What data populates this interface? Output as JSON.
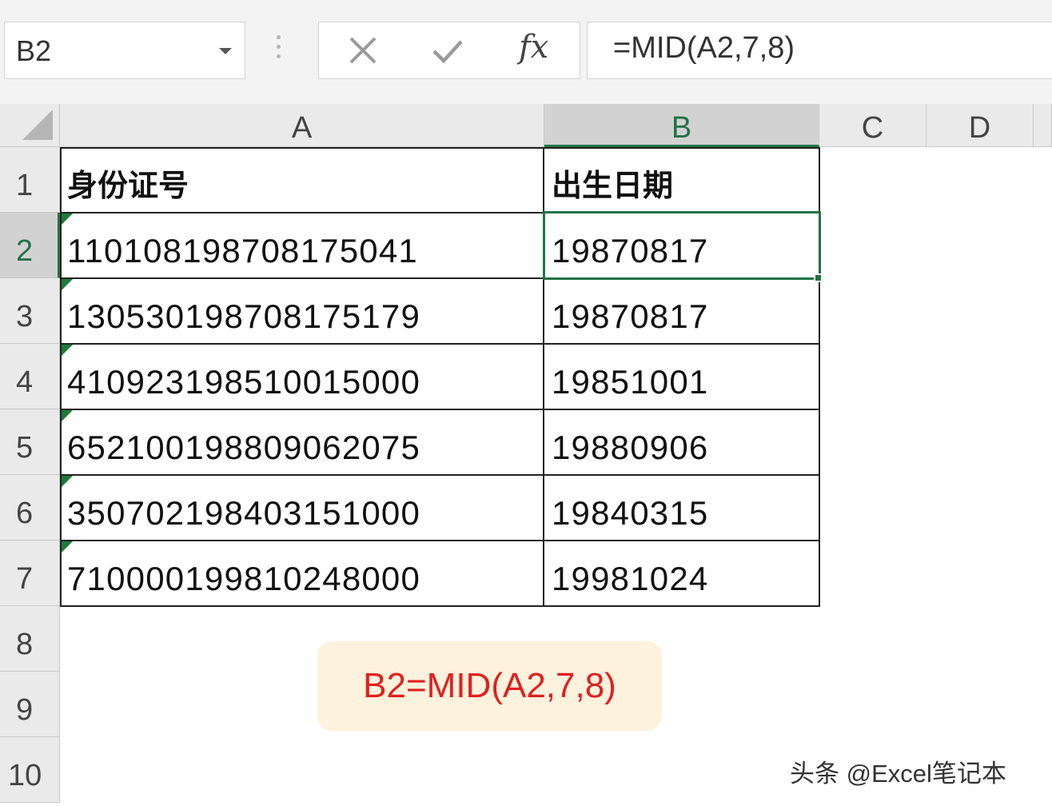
{
  "formula_bar": {
    "name_box": "B2",
    "formula": "=MID(A2,7,8)",
    "icons": {
      "cancel": "close-icon",
      "enter": "check-icon",
      "function": "fx-icon"
    },
    "fx_label": "fx"
  },
  "columns": [
    "A",
    "B",
    "C",
    "D"
  ],
  "rows": [
    "1",
    "2",
    "3",
    "4",
    "5",
    "6",
    "7",
    "8",
    "9",
    "10"
  ],
  "table": {
    "headers": [
      "身份证号",
      "出生日期"
    ],
    "data": [
      [
        "110108198708175041",
        "19870817"
      ],
      [
        "130530198708175179",
        "19870817"
      ],
      [
        "410923198510015000",
        "19851001"
      ],
      [
        "652100198809062075",
        "19880906"
      ],
      [
        "350702198403151000",
        "19840315"
      ],
      [
        "710000199810248000",
        "19981024"
      ]
    ]
  },
  "selection": {
    "active_cell": "B2",
    "accent_color": "#217346"
  },
  "annotation": {
    "text": "B2=MID(A2,7,8)",
    "color": "#e02020",
    "background": "#fdf2dd"
  },
  "watermark": "头条 @Excel笔记本"
}
